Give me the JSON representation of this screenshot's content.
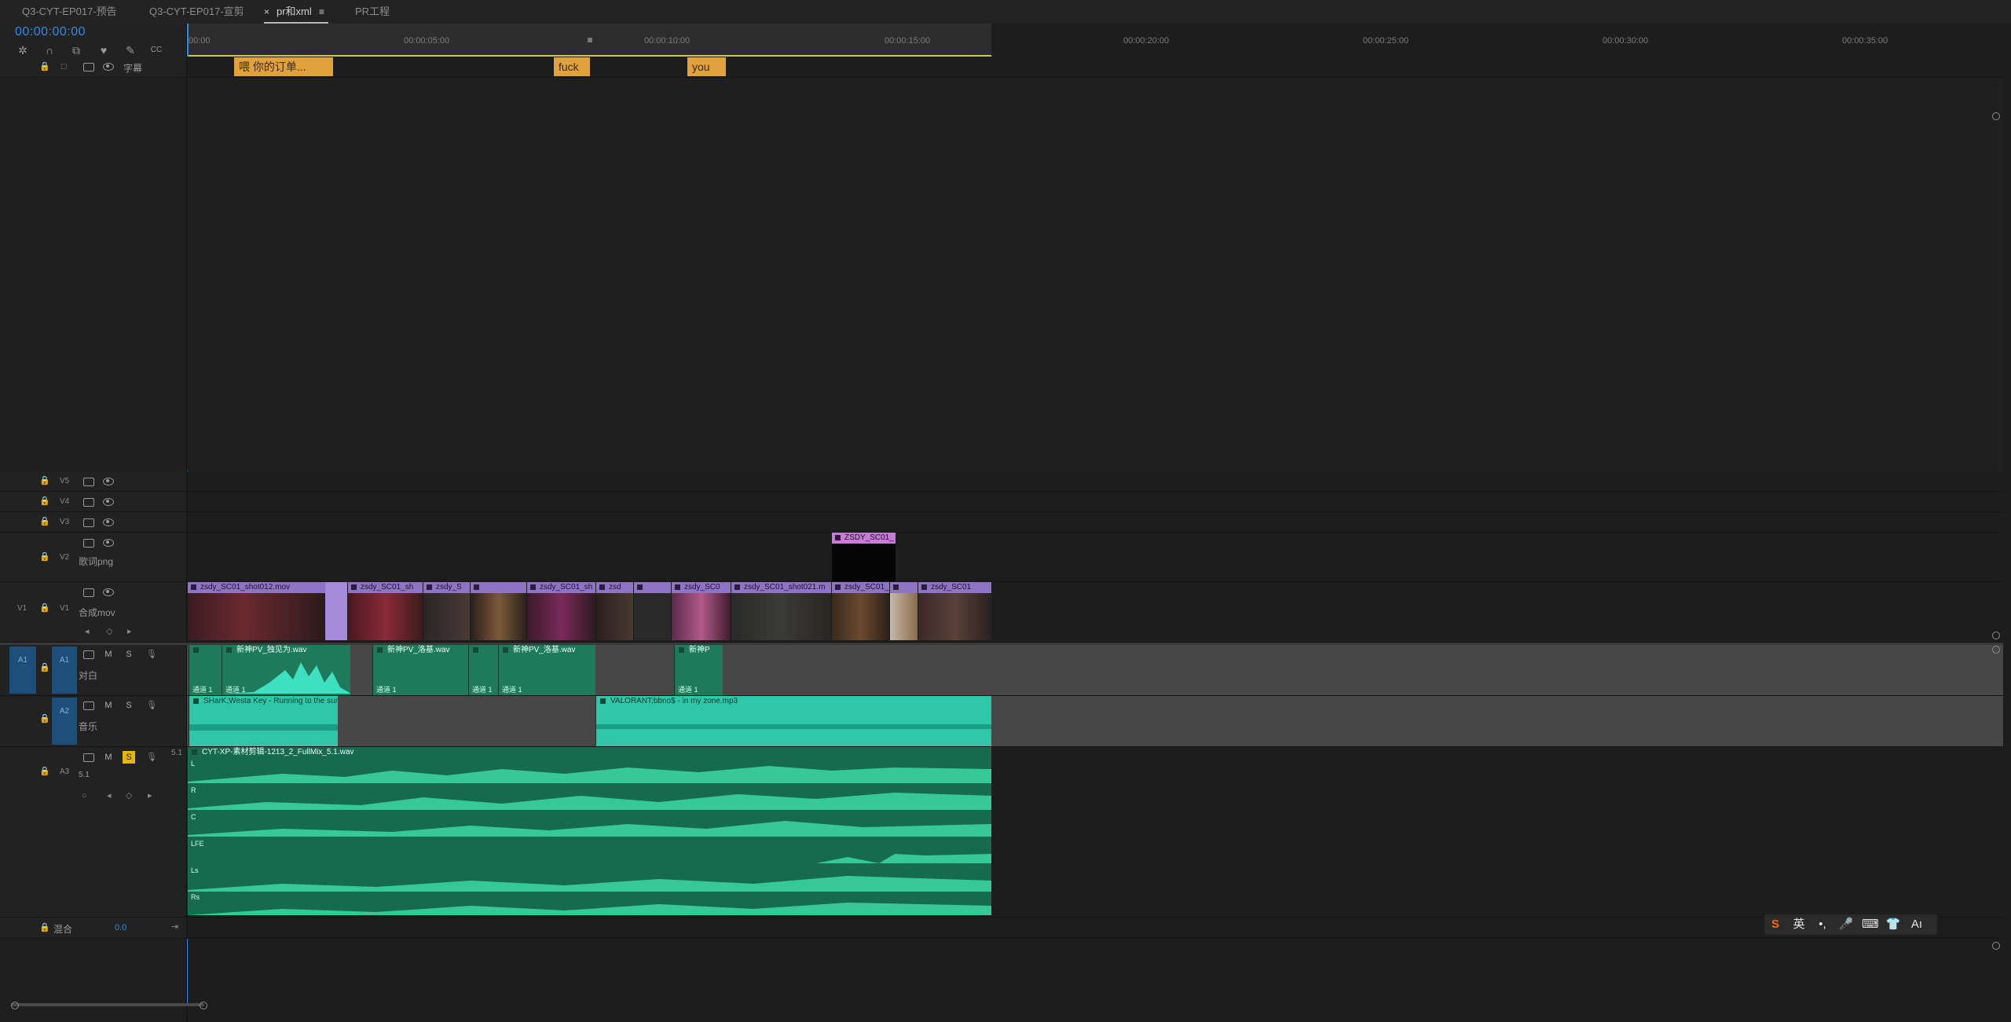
{
  "tabs": [
    {
      "label": "Q3-CYT-EP017-预告",
      "active": false
    },
    {
      "label": "Q3-CYT-EP017-宣剪",
      "active": false
    },
    {
      "label": "pr和xml",
      "active": true,
      "close": "×",
      "menu": "≡"
    },
    {
      "label": "PR工程",
      "active": false
    }
  ],
  "timecode": "00:00:00:00",
  "ruler": {
    "ticks": [
      "00:00",
      "00:00:05:00",
      "00:00:10:00",
      "00:00:15:00",
      "00:00:20:00",
      "00:00:25:00",
      "00:00:30:00",
      "00:00:35:00"
    ]
  },
  "header_icons": [
    "nest-icon",
    "snap-icon",
    "linked-selection-icon",
    "add-marker-icon",
    "wrench-icon",
    "captions-icon"
  ],
  "tracks": {
    "caption": {
      "name": "字幕"
    },
    "v5": {
      "id": "V5"
    },
    "v4": {
      "id": "V4"
    },
    "v3": {
      "id": "V3"
    },
    "v2": {
      "id": "V2",
      "name": "歌词png"
    },
    "v1": {
      "id": "V1",
      "src": "V1",
      "name": "合成mov"
    },
    "a1": {
      "id": "A1",
      "src": "A1",
      "name": "对白",
      "m": "M",
      "s": "S"
    },
    "a2": {
      "id": "A2",
      "name": "音乐",
      "m": "M",
      "s": "S"
    },
    "a3": {
      "id": "A3",
      "name": "5.1",
      "m": "M",
      "s": "S",
      "solo_active": true,
      "ch": "5.1"
    },
    "mix": {
      "name": "混合",
      "value": "0.0"
    }
  },
  "caption_clips": [
    "喂 你的订单...",
    "fuck",
    "you"
  ],
  "v2_clips": [
    "ZSDY_SC01_"
  ],
  "v1_clips": [
    "zsdy_SC01_shot012.mov",
    "zsdy_SC01_sh",
    "zsdy_S",
    "zsdy_SC01_sh",
    "zsd",
    "zsdy_SC0",
    "zsdy_SC01_shot021.m",
    "zsdy_SC01_s",
    "zsdy_SC01"
  ],
  "a1_clips": [
    "新神PV_独见为.wav",
    "新神PV_洛基.wav",
    "新神PV_洛基.wav",
    "新神P"
  ],
  "a1_channel": "通道 1",
  "a2_clips": [
    "SHarK;Westa Key - Running to the suns",
    "VALORANT;bbno$ - in my zone.mp3"
  ],
  "a3_clip": "CYT-XP-素材剪辑-1213_2_FullMix_5.1.wav",
  "a3_channels": [
    "L",
    "R",
    "C",
    "LFE",
    "Ls",
    "Rs"
  ],
  "ime": {
    "brand": "S",
    "lang": "英",
    "items": [
      "punct-icon",
      "mic-icon",
      "keyboard-icon",
      "skin-icon",
      "ai-icon"
    ]
  },
  "colors": {
    "accent": "#2d8ceb",
    "caption": "#e1a13d",
    "video": "#8f74c5",
    "audio": "#2fc7a8",
    "audio_dark": "#1e7a5a",
    "solo": "#e5b700"
  }
}
